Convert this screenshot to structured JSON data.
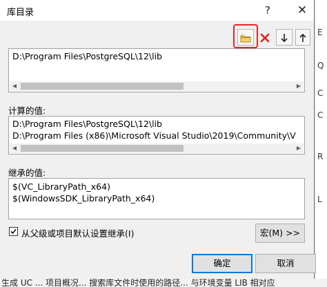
{
  "title": "库目录",
  "titlebar": {
    "help_label": "?",
    "close_label": "✕"
  },
  "toolbar": {
    "new_line_icon": "new-folder-icon",
    "delete_icon": "red-x-icon",
    "move_down_icon": "arrow-down-icon",
    "move_up_icon": "arrow-up-icon"
  },
  "edit_box": {
    "lines": [
      "D:\\Program Files\\PostgreSQL\\12\\lib"
    ]
  },
  "evaluated": {
    "label": "计算的值:",
    "lines": [
      "D:\\Program Files\\PostgreSQL\\12\\lib",
      "D:\\Program Files (x86)\\Microsoft Visual Studio\\2019\\Community\\V"
    ]
  },
  "inherited": {
    "label": "继承的值:",
    "lines": [
      "$(VC_LibraryPath_x64)",
      "$(WindowsSDK_LibraryPath_x64)"
    ]
  },
  "inherit_checkbox": {
    "label": "从父级或项目默认设置继承(I)",
    "checked": true
  },
  "buttons": {
    "macro": "宏(M) >>",
    "ok": "确定",
    "cancel": "取消"
  },
  "background": {
    "side_chars": [
      "E",
      "Q",
      "C",
      "C",
      "R",
      "L"
    ],
    "bottom_text": "   生成 UC ...   项目概况...   搜索库文件时使用的路径...   与环境变量 LIB 相对应"
  },
  "colors": {
    "highlight": "#e8232a",
    "accent": "#0078d7",
    "delete": "#d9261c"
  }
}
